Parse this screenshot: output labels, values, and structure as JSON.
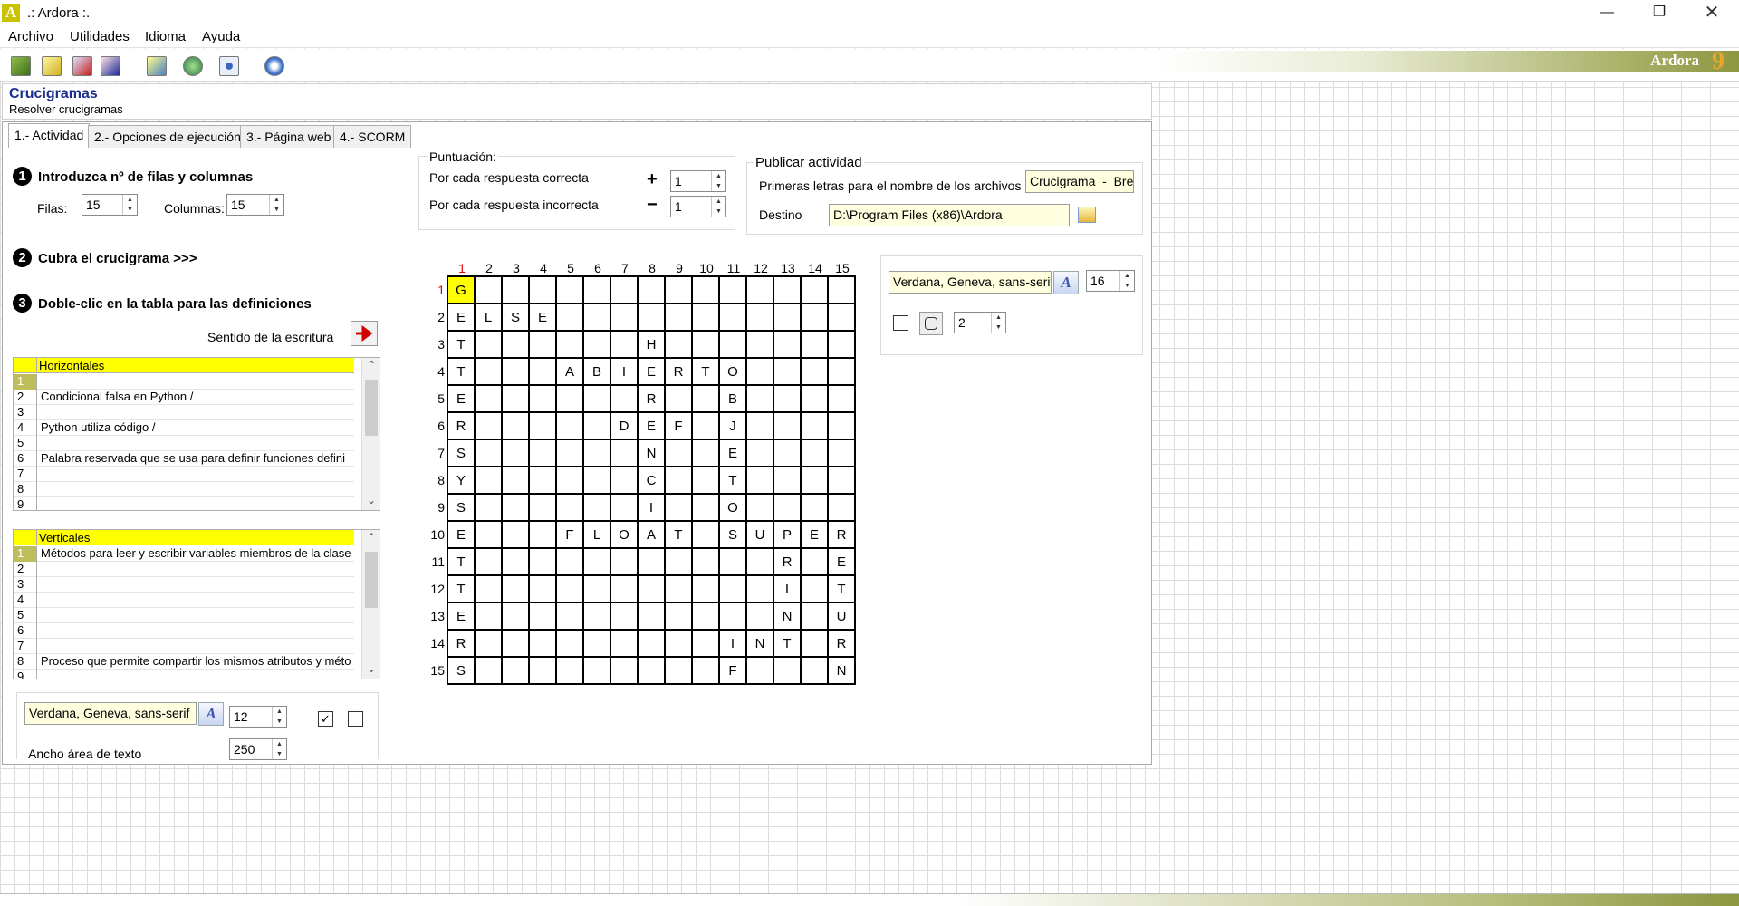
{
  "window": {
    "title": ".: Ardora :.",
    "logo_letter": "A",
    "min": "—",
    "max": "❐",
    "close": "✕"
  },
  "menu": [
    "Archivo",
    "Utilidades",
    "Idioma",
    "Ayuda"
  ],
  "brand": {
    "name": "Ardora",
    "version": "9"
  },
  "header": {
    "title": "Crucigramas",
    "subtitle": "Resolver crucigramas"
  },
  "tabs": [
    "1.- Actividad",
    "2.- Opciones de ejecución",
    "3.- Página web",
    "4.- SCORM"
  ],
  "step1": {
    "num": "1",
    "label": "Introduzca nº de filas y columnas",
    "filas_label": "Filas:",
    "filas": "15",
    "columnas_label": "Columnas:",
    "columnas": "15"
  },
  "step2": {
    "num": "2",
    "label": "Cubra el crucigrama >>>"
  },
  "step3": {
    "num": "3",
    "label": "Doble-clic en la tabla para las definiciones",
    "direction_label": "Sentido de la escritura",
    "direction_icon": "arrow-right-icon"
  },
  "horizontales": {
    "header": "Horizontales",
    "rows": [
      {
        "n": "1",
        "text": ""
      },
      {
        "n": "2",
        "text": "Condicional falsa en Python /"
      },
      {
        "n": "3",
        "text": ""
      },
      {
        "n": "4",
        "text": "Python utiliza código /"
      },
      {
        "n": "5",
        "text": ""
      },
      {
        "n": "6",
        "text": "Palabra reservada que se usa para definir funciones defini"
      },
      {
        "n": "7",
        "text": ""
      },
      {
        "n": "8",
        "text": ""
      },
      {
        "n": "9",
        "text": ""
      }
    ]
  },
  "verticales": {
    "header": "Verticales",
    "rows": [
      {
        "n": "1",
        "text": "Métodos para leer y escribir variables miembros de la clase"
      },
      {
        "n": "2",
        "text": ""
      },
      {
        "n": "3",
        "text": ""
      },
      {
        "n": "4",
        "text": ""
      },
      {
        "n": "5",
        "text": ""
      },
      {
        "n": "6",
        "text": ""
      },
      {
        "n": "7",
        "text": ""
      },
      {
        "n": "8",
        "text": "Proceso que permite compartir los mismos atributos y méto"
      },
      {
        "n": "9",
        "text": ""
      }
    ]
  },
  "font_bottom": {
    "font": "Verdana, Geneva, sans-serif",
    "size": "12",
    "bold_check": "✓",
    "width_label": "Ancho área de texto",
    "width": "250"
  },
  "puntuacion": {
    "title": "Puntuación:",
    "correct_label": "Por cada respuesta correcta",
    "correct_sign": "+",
    "correct": "1",
    "incorrect_label": "Por cada respuesta incorrecta",
    "incorrect_sign": "−",
    "incorrect": "1"
  },
  "publicar": {
    "title": "Publicar actividad",
    "prefix_label": "Primeras letras para el nombre de los archivos",
    "prefix": "Crucigrama_-_Bren",
    "dest_label": "Destino",
    "dest": "D:\\Program Files (x86)\\Ardora"
  },
  "font_grid": {
    "font": "Verdana, Geneva, sans-serif",
    "size": "16",
    "border": "2"
  },
  "grid": {
    "col_headers": [
      "1",
      "2",
      "3",
      "4",
      "5",
      "6",
      "7",
      "8",
      "9",
      "10",
      "11",
      "12",
      "13",
      "14",
      "15"
    ],
    "row_headers": [
      "1",
      "2",
      "3",
      "4",
      "5",
      "6",
      "7",
      "8",
      "9",
      "10",
      "11",
      "12",
      "13",
      "14",
      "15"
    ],
    "rows": [
      "G              ",
      "ELSE           ",
      "T      H       ",
      "T   ABIERTO    ",
      "E      R  B    ",
      "R     DEF J    ",
      "S      N  E    ",
      "Y      C  T    ",
      "S      I  O    ",
      "E   FLOAT SUPER",
      "T           R E",
      "T           I T",
      "E           N U",
      "R         INT R",
      "S         F   N"
    ]
  }
}
